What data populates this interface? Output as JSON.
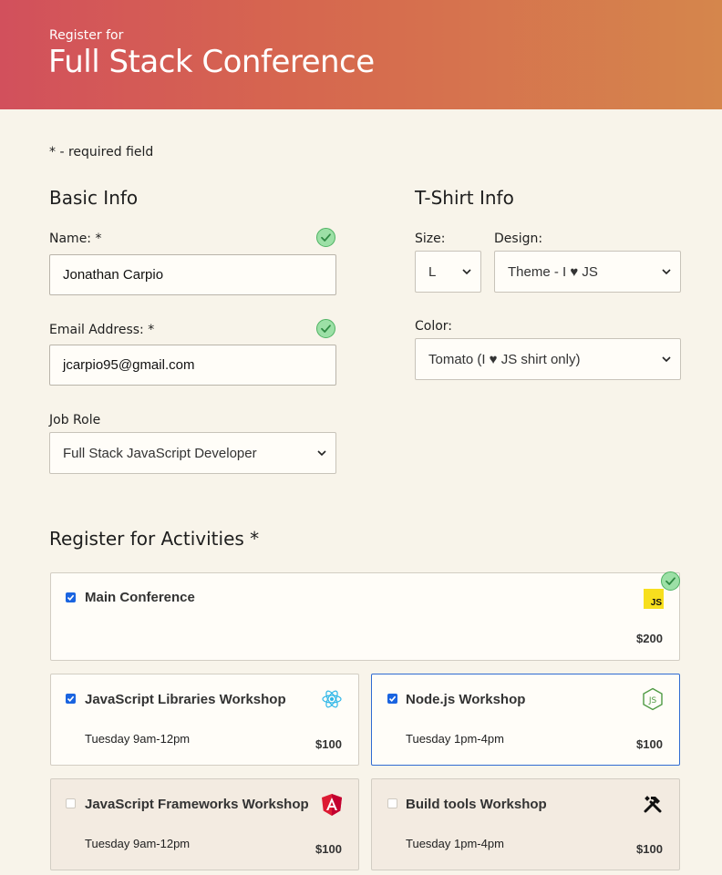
{
  "header": {
    "subtitle": "Register for",
    "title": "Full Stack Conference"
  },
  "required_note": "- required field",
  "required_marker": "*",
  "basic_info": {
    "heading": "Basic Info",
    "name": {
      "label": "Name:",
      "value": "Jonathan Carpio"
    },
    "email": {
      "label": "Email Address:",
      "value": "jcarpio95@gmail.com"
    },
    "job_role": {
      "label": "Job Role",
      "value": "Full Stack JavaScript Developer"
    }
  },
  "tshirt_info": {
    "heading": "T-Shirt Info",
    "size": {
      "label": "Size:",
      "value": "L"
    },
    "design": {
      "label": "Design:",
      "value": "Theme - I ♥ JS"
    },
    "color": {
      "label": "Color:",
      "value": "Tomato (I ♥ JS shirt only)"
    }
  },
  "activities": {
    "heading": "Register for Activities",
    "items": [
      {
        "name": "Main Conference",
        "time": "",
        "price": "$200",
        "checked": true,
        "icon": "javascript-icon"
      },
      {
        "name": "JavaScript Libraries Workshop",
        "time": "Tuesday 9am-12pm",
        "price": "$100",
        "checked": true,
        "icon": "react-icon"
      },
      {
        "name": "Node.js Workshop",
        "time": "Tuesday 1pm-4pm",
        "price": "$100",
        "checked": true,
        "icon": "nodejs-icon"
      },
      {
        "name": "JavaScript Frameworks Workshop",
        "time": "Tuesday 9am-12pm",
        "price": "$100",
        "checked": false,
        "icon": "angular-icon"
      },
      {
        "name": "Build tools Workshop",
        "time": "Tuesday 1pm-4pm",
        "price": "$100",
        "checked": false,
        "icon": "tools-icon"
      }
    ]
  },
  "colors": {
    "header_start": "#d2505c",
    "header_end": "#d5864c",
    "background": "#f8f4ea",
    "checkbox_accent": "#1a64e0",
    "valid_green": "#9ce0a6"
  }
}
